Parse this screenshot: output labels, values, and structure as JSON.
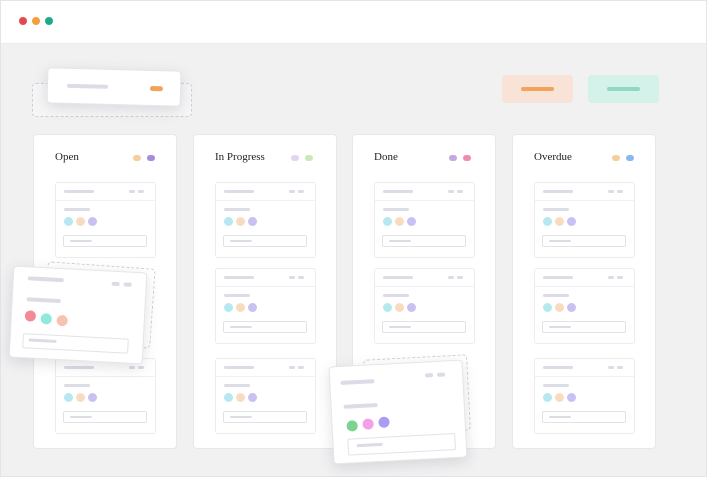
{
  "colors": {
    "close": "#e5484d",
    "minimize": "#f59e3a",
    "maximize": "#1fa98b",
    "orange_button": "#f8e3d6",
    "orange_line": "#f2a45a",
    "teal_button": "#d4f1ea",
    "teal_line": "#8fd9c2"
  },
  "columns": [
    {
      "title": "Open",
      "tags": [
        "#f5cf9a",
        "#a58bd8"
      ]
    },
    {
      "title": "In Progress",
      "tags": [
        "#e3d4f1",
        "#cbe9b8"
      ]
    },
    {
      "title": "Done",
      "tags": [
        "#c7a7e3",
        "#f08ab3"
      ]
    },
    {
      "title": "Overdue",
      "tags": [
        "#f5cf9a",
        "#8bb7f0"
      ]
    }
  ],
  "card_avatars": [
    "#b3e9ef",
    "#f8dcc0",
    "#c9c1f2"
  ],
  "floating_card_avatars": [
    "#f28b95",
    "#8fe9dc",
    "#f8c2b0"
  ],
  "floating_card_done_avatars": [
    "#7ad38f",
    "#f2a0e8",
    "#a99cf2"
  ]
}
